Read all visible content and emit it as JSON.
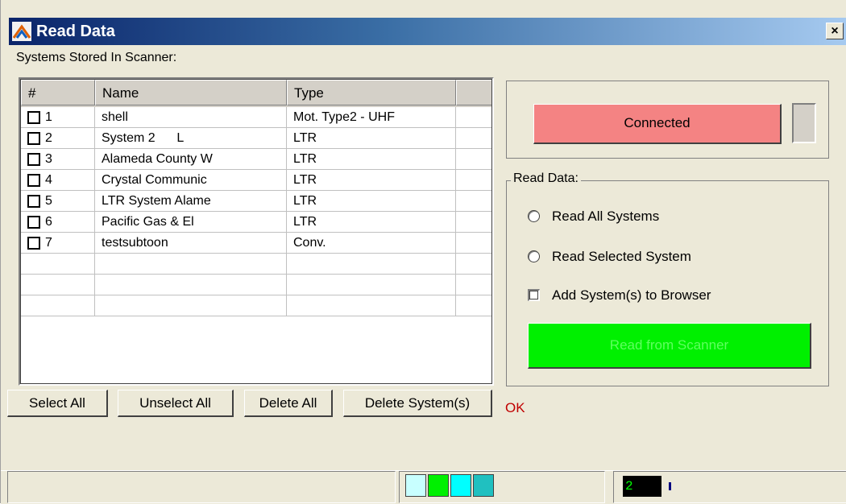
{
  "window": {
    "title": "Read Data",
    "close_label": "×"
  },
  "systems_label": "Systems Stored In Scanner:",
  "table": {
    "headers": [
      "#",
      "Name",
      "Type",
      ""
    ],
    "rows": [
      {
        "num": "1",
        "name": "shell",
        "type": "Mot. Type2 - UHF"
      },
      {
        "num": "2",
        "name": "System 2      L",
        "type": "LTR"
      },
      {
        "num": "3",
        "name": "Alameda County W",
        "type": "LTR"
      },
      {
        "num": "4",
        "name": "Crystal Communic",
        "type": "LTR"
      },
      {
        "num": "5",
        "name": "LTR System Alame",
        "type": "LTR"
      },
      {
        "num": "6",
        "name": "Pacific Gas & El",
        "type": "LTR"
      },
      {
        "num": "7",
        "name": "testsubtoon",
        "type": "Conv."
      }
    ],
    "empty_rows": 3
  },
  "buttons": {
    "select_all": "Select All",
    "unselect_all": "Unselect All",
    "delete_all": "Delete All",
    "delete_systems": "Delete System(s)"
  },
  "status_message": "OK",
  "connection": {
    "label": "Connected",
    "color": "#f48383"
  },
  "read_group": {
    "legend": "Read Data:",
    "opt_all": "Read All Systems",
    "opt_selected": "Read Selected System",
    "add_browser": "Add System(s) to Browser",
    "read_button": "Read from Scanner"
  },
  "statusbar": {
    "swatches": [
      "#c8ffff",
      "#00f000",
      "#00ffff",
      "#20c0c0"
    ],
    "counter": "2"
  }
}
